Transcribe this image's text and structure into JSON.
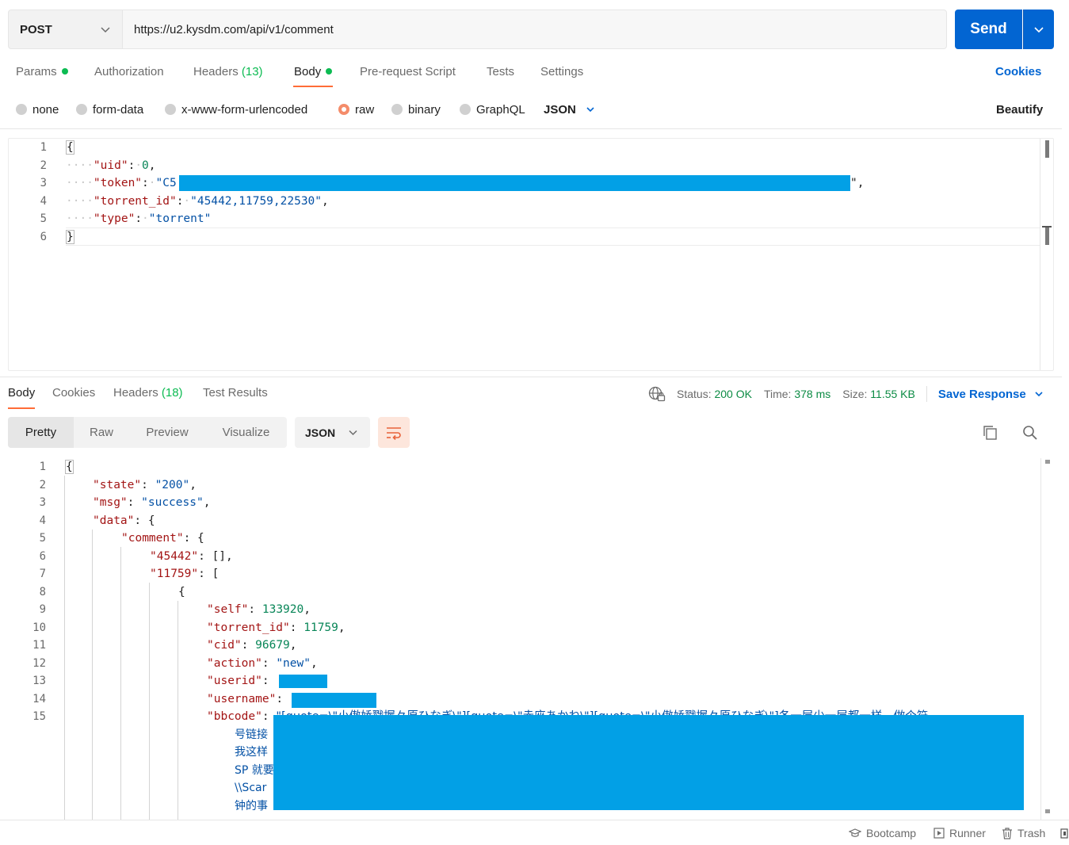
{
  "request": {
    "method": "POST",
    "url": "https://u2.kysdm.com/api/v1/comment",
    "send_label": "Send"
  },
  "request_tabs": {
    "params": "Params",
    "authorization": "Authorization",
    "headers": "Headers",
    "headers_count": "(13)",
    "body": "Body",
    "pre_request": "Pre-request Script",
    "tests": "Tests",
    "settings": "Settings",
    "cookies": "Cookies"
  },
  "body_types": {
    "none": "none",
    "form_data": "form-data",
    "urlencoded": "x-www-form-urlencoded",
    "raw": "raw",
    "binary": "binary",
    "graphql": "GraphQL",
    "format": "JSON",
    "beautify": "Beautify"
  },
  "request_body": {
    "line_numbers": [
      "1",
      "2",
      "3",
      "4",
      "5",
      "6"
    ],
    "open": "{",
    "close": "}",
    "uid_key": "\"uid\"",
    "uid_val": "0",
    "token_key": "\"token\"",
    "token_prefix": "\"C5",
    "token_suffix": "\",",
    "torrent_key": "\"torrent_id\"",
    "torrent_val": "\"45442,11759,22530\"",
    "type_key": "\"type\"",
    "type_val": "\"torrent\""
  },
  "response_tabs": {
    "body": "Body",
    "cookies": "Cookies",
    "headers": "Headers",
    "headers_count": "(18)",
    "test_results": "Test Results"
  },
  "response_status": {
    "status_label": "Status:",
    "status_value": "200 OK",
    "time_label": "Time:",
    "time_value": "378 ms",
    "size_label": "Size:",
    "size_value": "11.55 KB",
    "save_response": "Save Response"
  },
  "view_modes": {
    "pretty": "Pretty",
    "raw": "Raw",
    "preview": "Preview",
    "visualize": "Visualize",
    "format": "JSON"
  },
  "response_body": {
    "line_numbers": [
      "1",
      "2",
      "3",
      "4",
      "5",
      "6",
      "7",
      "8",
      "9",
      "10",
      "11",
      "12",
      "13",
      "14",
      "15"
    ],
    "open": "{",
    "state_key": "\"state\"",
    "state_val": "\"200\"",
    "msg_key": "\"msg\"",
    "msg_val": "\"success\"",
    "data_key": "\"data\"",
    "comment_key": "\"comment\"",
    "id1_key": "\"45442\"",
    "id1_val": "[],",
    "id2_key": "\"11759\"",
    "id2_open": "[",
    "obj_open": "{",
    "self_key": "\"self\"",
    "self_val": "133920",
    "torrent_key": "\"torrent_id\"",
    "torrent_val": "11759",
    "cid_key": "\"cid\"",
    "cid_val": "96679",
    "action_key": "\"action\"",
    "action_val": "\"new\"",
    "userid_key": "\"userid\"",
    "username_key": "\"username\"",
    "bbcode_key": "\"bbcode\"",
    "bbcode_line1": "\"[quote=\\\"小傲娇戳握々原ひなぎ\\\"][quote=\\\"赤座あかね\\\"][quote=\\\"小傲娇戳握々原ひなぎ\\\"]各一层少一层都一样，做个符",
    "bbcode_line2": "号链接",
    "bbcode_line3": "我这样",
    "bbcode_line4": "SP 就要",
    "bbcode_line5": "\\\\Scar",
    "bbcode_line6": "钟的事"
  },
  "footer": {
    "bootcamp": "Bootcamp",
    "runner": "Runner",
    "trash": "Trash"
  },
  "colors": {
    "accent": "#ff6c37",
    "primary": "#0265d2",
    "success": "#0cbb52",
    "redaction": "#02a0e6"
  }
}
